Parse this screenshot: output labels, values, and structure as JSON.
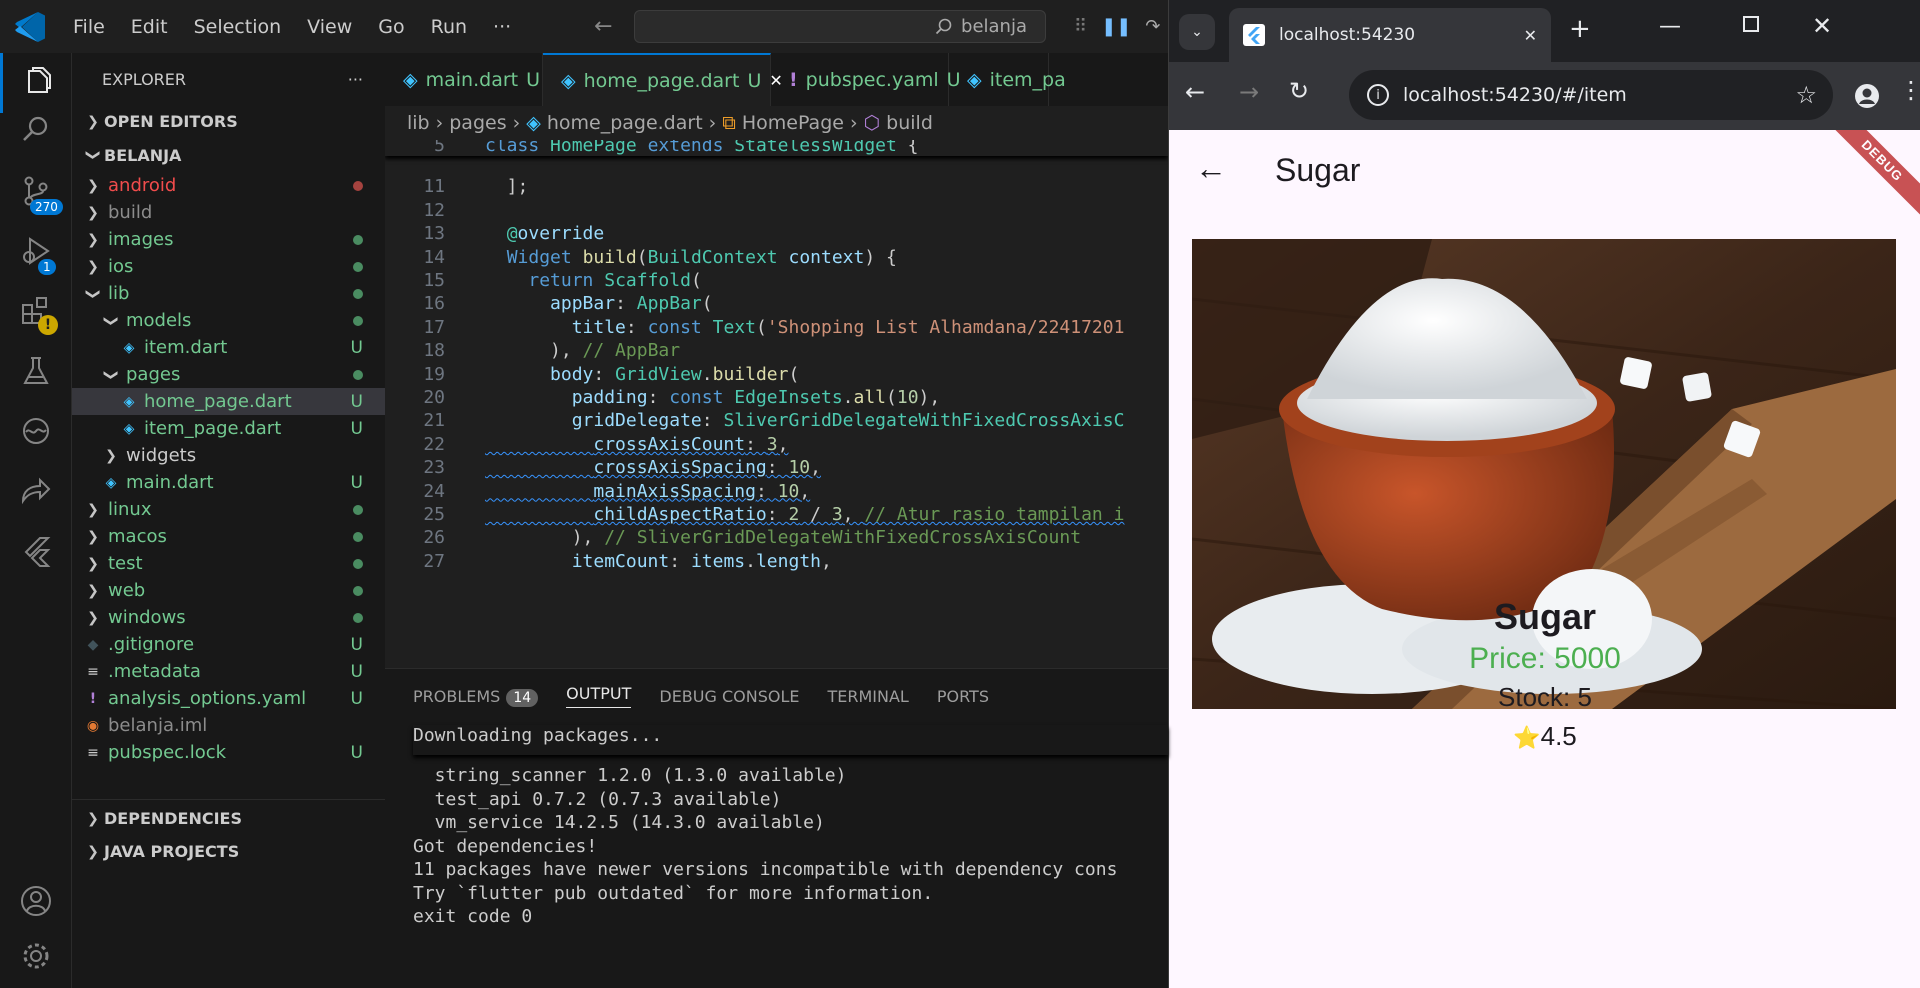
{
  "vscode": {
    "menu": [
      "File",
      "Edit",
      "Selection",
      "View",
      "Go",
      "Run",
      "···"
    ],
    "search": "belanja",
    "activity_badges": {
      "source_control": "270",
      "run_debug": "1"
    },
    "explorer": {
      "header": "EXPLORER",
      "more": "···",
      "open_editors": "OPEN EDITORS",
      "project": "BELANJA",
      "items": [
        {
          "label": "android",
          "status": "dot",
          "color": "#f14c4c",
          "indent": 1,
          "folder": true
        },
        {
          "label": "build",
          "status": "",
          "color": "#8c8c8c",
          "indent": 1,
          "folder": true
        },
        {
          "label": "images",
          "status": "dot",
          "color": "#73c991",
          "indent": 1,
          "folder": true
        },
        {
          "label": "ios",
          "status": "dot",
          "color": "#73c991",
          "indent": 1,
          "folder": true
        },
        {
          "label": "lib",
          "status": "dot",
          "color": "#73c991",
          "indent": 1,
          "folder": true,
          "open": true
        },
        {
          "label": "models",
          "status": "dot",
          "color": "#73c991",
          "indent": 2,
          "folder": true,
          "open": true
        },
        {
          "label": "item.dart",
          "status": "U",
          "color": "#73c991",
          "indent": 3,
          "dart": true
        },
        {
          "label": "pages",
          "status": "dot",
          "color": "#73c991",
          "indent": 2,
          "folder": true,
          "open": true
        },
        {
          "label": "home_page.dart",
          "status": "U",
          "color": "#73c991",
          "indent": 3,
          "dart": true,
          "selected": true
        },
        {
          "label": "item_page.dart",
          "status": "U",
          "color": "#73c991",
          "indent": 3,
          "dart": true
        },
        {
          "label": "widgets",
          "status": "",
          "color": "#cccccc",
          "indent": 2,
          "folder": true
        },
        {
          "label": "main.dart",
          "status": "U",
          "color": "#73c991",
          "indent": 2,
          "dart": true
        },
        {
          "label": "linux",
          "status": "dot",
          "color": "#73c991",
          "indent": 1,
          "folder": true
        },
        {
          "label": "macos",
          "status": "dot",
          "color": "#73c991",
          "indent": 1,
          "folder": true
        },
        {
          "label": "test",
          "status": "dot",
          "color": "#73c991",
          "indent": 1,
          "folder": true
        },
        {
          "label": "web",
          "status": "dot",
          "color": "#73c991",
          "indent": 1,
          "folder": true
        },
        {
          "label": "windows",
          "status": "dot",
          "color": "#73c991",
          "indent": 1,
          "folder": true
        },
        {
          "label": ".gitignore",
          "status": "U",
          "color": "#73c991",
          "indent": 1,
          "icon": "git"
        },
        {
          "label": ".metadata",
          "status": "U",
          "color": "#73c991",
          "indent": 1,
          "icon": "lines"
        },
        {
          "label": "analysis_options.yaml",
          "status": "U",
          "color": "#73c991",
          "indent": 1,
          "icon": "excl"
        },
        {
          "label": "belanja.iml",
          "status": "",
          "color": "#8c8c8c",
          "indent": 1,
          "icon": "rss"
        },
        {
          "label": "pubspec.lock",
          "status": "U",
          "color": "#73c991",
          "indent": 1,
          "icon": "lines"
        }
      ],
      "dependencies": "DEPENDENCIES",
      "java_projects": "JAVA PROJECTS"
    },
    "tabs": [
      {
        "label": "main.dart",
        "status": "U",
        "icon": "dart"
      },
      {
        "label": "home_page.dart",
        "status": "U",
        "icon": "dart",
        "active": true,
        "close": "✕"
      },
      {
        "label": "pubspec.yaml",
        "status": "U",
        "icon": "excl"
      },
      {
        "label": "item_pa",
        "status": "",
        "icon": "dart"
      }
    ],
    "breadcrumbs": [
      "lib",
      "pages",
      "home_page.dart",
      "HomePage",
      "build"
    ],
    "code": [
      {
        "n": "5",
        "t": "class HomePage extends StatelessWidget {"
      },
      {
        "n": "11",
        "t": "  ];"
      },
      {
        "n": "12",
        "t": ""
      },
      {
        "n": "13",
        "t": "  @override"
      },
      {
        "n": "14",
        "t": "  Widget build(BuildContext context) {"
      },
      {
        "n": "15",
        "t": "    return Scaffold("
      },
      {
        "n": "16",
        "t": "      appBar: AppBar("
      },
      {
        "n": "17",
        "t": "        title: const Text('Shopping List Alhamdana/22417201"
      },
      {
        "n": "18",
        "t": "      ), // AppBar"
      },
      {
        "n": "19",
        "t": "      body: GridView.builder("
      },
      {
        "n": "20",
        "t": "        padding: const EdgeInsets.all(10),"
      },
      {
        "n": "21",
        "t": "        gridDelegate: SliverGridDelegateWithFixedCrossAxisC"
      },
      {
        "n": "22",
        "t": "          crossAxisCount: 3,"
      },
      {
        "n": "23",
        "t": "          crossAxisSpacing: 10,"
      },
      {
        "n": "24",
        "t": "          mainAxisSpacing: 10,"
      },
      {
        "n": "25",
        "t": "          childAspectRatio: 2 / 3, // Atur rasio tampilan i"
      },
      {
        "n": "26",
        "t": "        ), // SliverGridDelegateWithFixedCrossAxisCount"
      },
      {
        "n": "27",
        "t": "        itemCount: items.length,"
      }
    ],
    "panel": {
      "tabs": [
        "PROBLEMS",
        "OUTPUT",
        "DEBUG CONSOLE",
        "TERMINAL",
        "PORTS"
      ],
      "problems_count": "14",
      "sticky": "Downloading packages...",
      "lines": [
        "  string_scanner 1.2.0 (1.3.0 available)",
        "  test_api 0.7.2 (0.7.3 available)",
        "  vm_service 14.2.5 (14.3.0 available)",
        "Got dependencies!",
        "11 packages have newer versions incompatible with dependency cons",
        "Try `flutter pub outdated` for more information.",
        "exit code 0"
      ]
    }
  },
  "browser": {
    "tab_title": "localhost:54230",
    "url": "localhost:54230/#/item",
    "app": {
      "title": "Sugar",
      "debug": "DEBUG",
      "name": "Sugar",
      "price": "Price: 5000",
      "stock": "Stock: 5",
      "rating": "4.5",
      "rating_icon": "⭐"
    }
  }
}
